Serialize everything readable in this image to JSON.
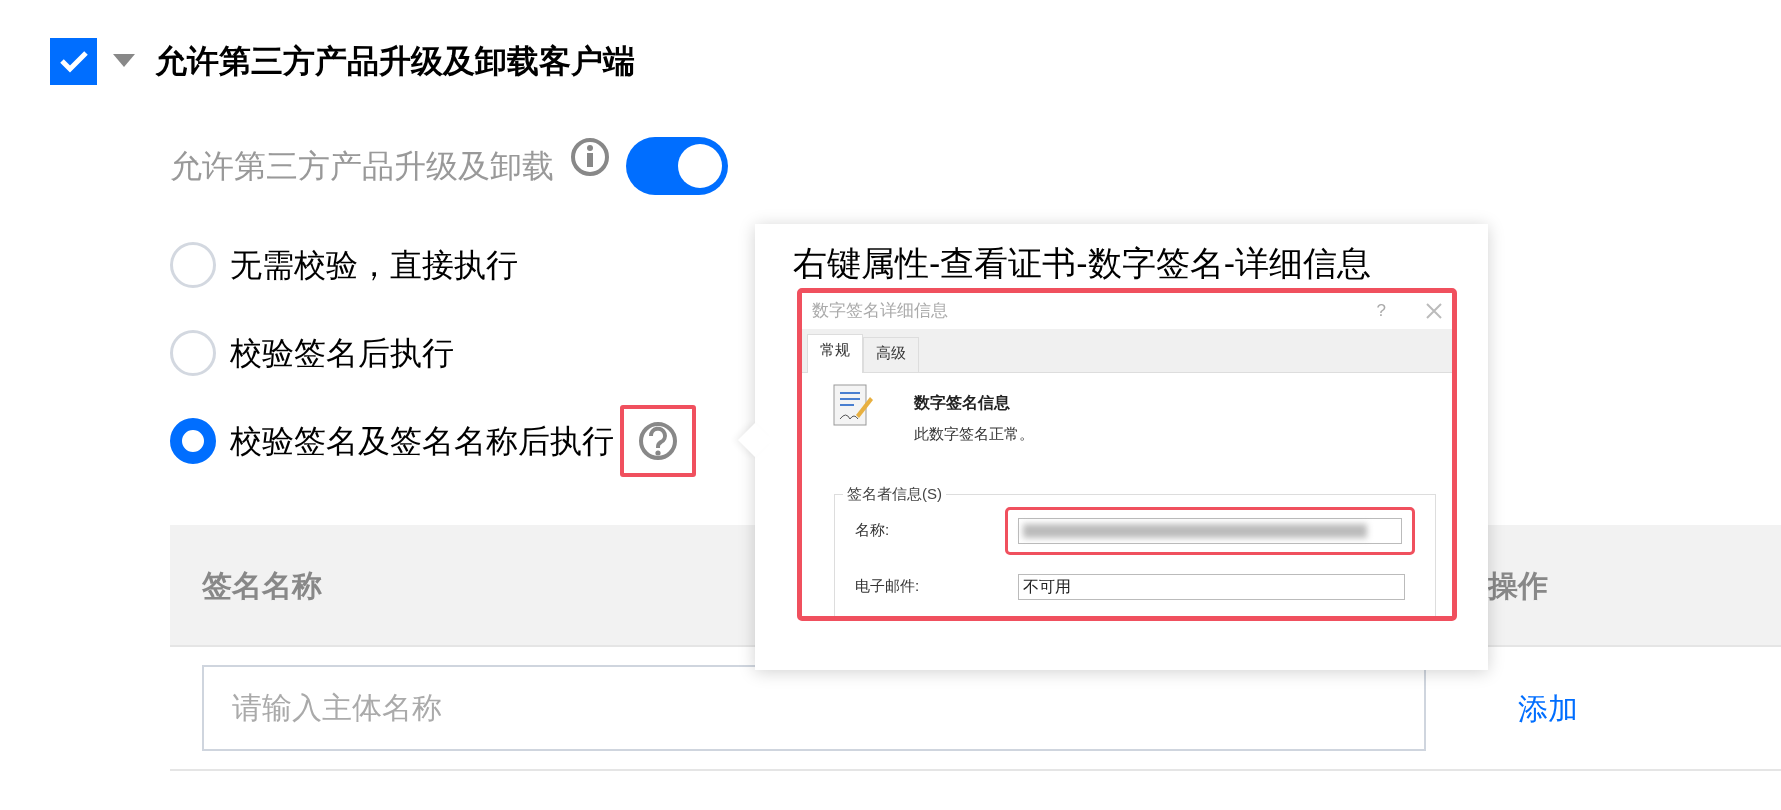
{
  "section": {
    "title": "允许第三方产品升级及卸载客户端",
    "checked": true,
    "expanded": true
  },
  "toggle_row": {
    "label": "允许第三方产品升级及卸载",
    "on": true
  },
  "options": [
    {
      "label": "无需校验，直接执行",
      "selected": false,
      "help": false
    },
    {
      "label": "校验签名后执行",
      "selected": false,
      "help": false
    },
    {
      "label": "校验签名及签名名称后执行",
      "selected": true,
      "help": true
    }
  ],
  "popover": {
    "title": "右键属性-查看证书-数字签名-详细信息",
    "screenshot": {
      "title": "数字签名详细信息",
      "help": "?",
      "tabs": [
        {
          "label": "常规",
          "selected": true
        },
        {
          "label": "高级",
          "selected": false
        }
      ],
      "heading": "数字签名信息",
      "status": "此数字签名正常。",
      "group": "签名者信息(S)",
      "fields": [
        {
          "label": "名称:",
          "kind": "blurred",
          "highlighted": true
        },
        {
          "label": "电子邮件:",
          "kind": "text",
          "value": "不可用",
          "highlighted": false
        }
      ]
    }
  },
  "table": {
    "columns": [
      "签名名称",
      "操作"
    ],
    "input": {
      "placeholder": "请输入主体名称"
    },
    "action": "添加"
  }
}
